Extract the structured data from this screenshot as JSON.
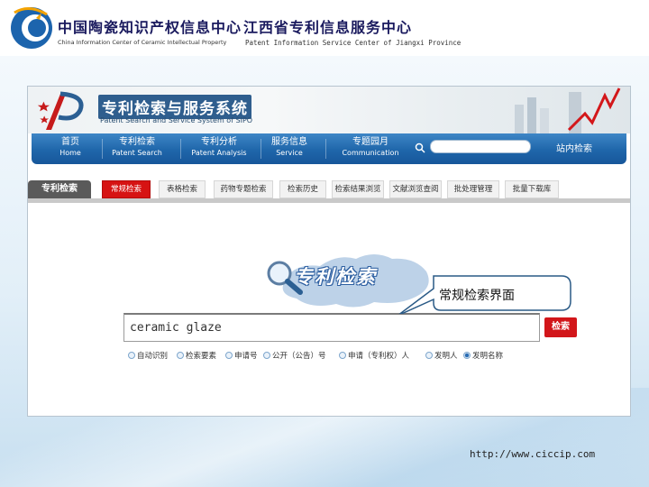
{
  "header": {
    "org_cn": "中国陶瓷知识产权信息中心",
    "org_en": "China Information Center of Ceramic Intellectual Property",
    "org2_cn": "江西省专利信息服务中心",
    "org2_en": "Patent Information Service Center of  Jiangxi  Province"
  },
  "app": {
    "title": "专利检索与服务系统",
    "subtitle": "Patent Search and Service System of SIPO"
  },
  "nav": {
    "items": [
      {
        "cn": "首页",
        "en": "Home"
      },
      {
        "cn": "专利检索",
        "en": "Patent Search"
      },
      {
        "cn": "专利分析",
        "en": "Patent Analysis"
      },
      {
        "cn": "服务信息",
        "en": "Service"
      },
      {
        "cn": "专题园月",
        "en": "Communication"
      }
    ],
    "search_placeholder": "",
    "search_button": "站内检索"
  },
  "tabs": {
    "current_label": "专利检索",
    "items": [
      "常规检索",
      "表格检索",
      "药物专题检索",
      "检索历史",
      "检索结果浏览",
      "文献浏览查阅",
      "批处理管理",
      "批量下载库"
    ],
    "active_index": 0
  },
  "search": {
    "title": "专利检索",
    "query": "ceramic glaze",
    "button": "检索",
    "options": [
      "自动识别",
      "检索要素",
      "申请号",
      "公开（公告）号",
      "申请（专利权）人",
      "发明人",
      "发明名称"
    ],
    "selected_index": 6
  },
  "annotation": {
    "callout": "常规检索界面"
  },
  "footer": {
    "url": "http://www.ciccip.com"
  },
  "colors": {
    "header_rule": "#0f6bb7",
    "nav_blue": "#1f66aa",
    "active_tab": "#d61313",
    "search_button": "#d2161a"
  }
}
